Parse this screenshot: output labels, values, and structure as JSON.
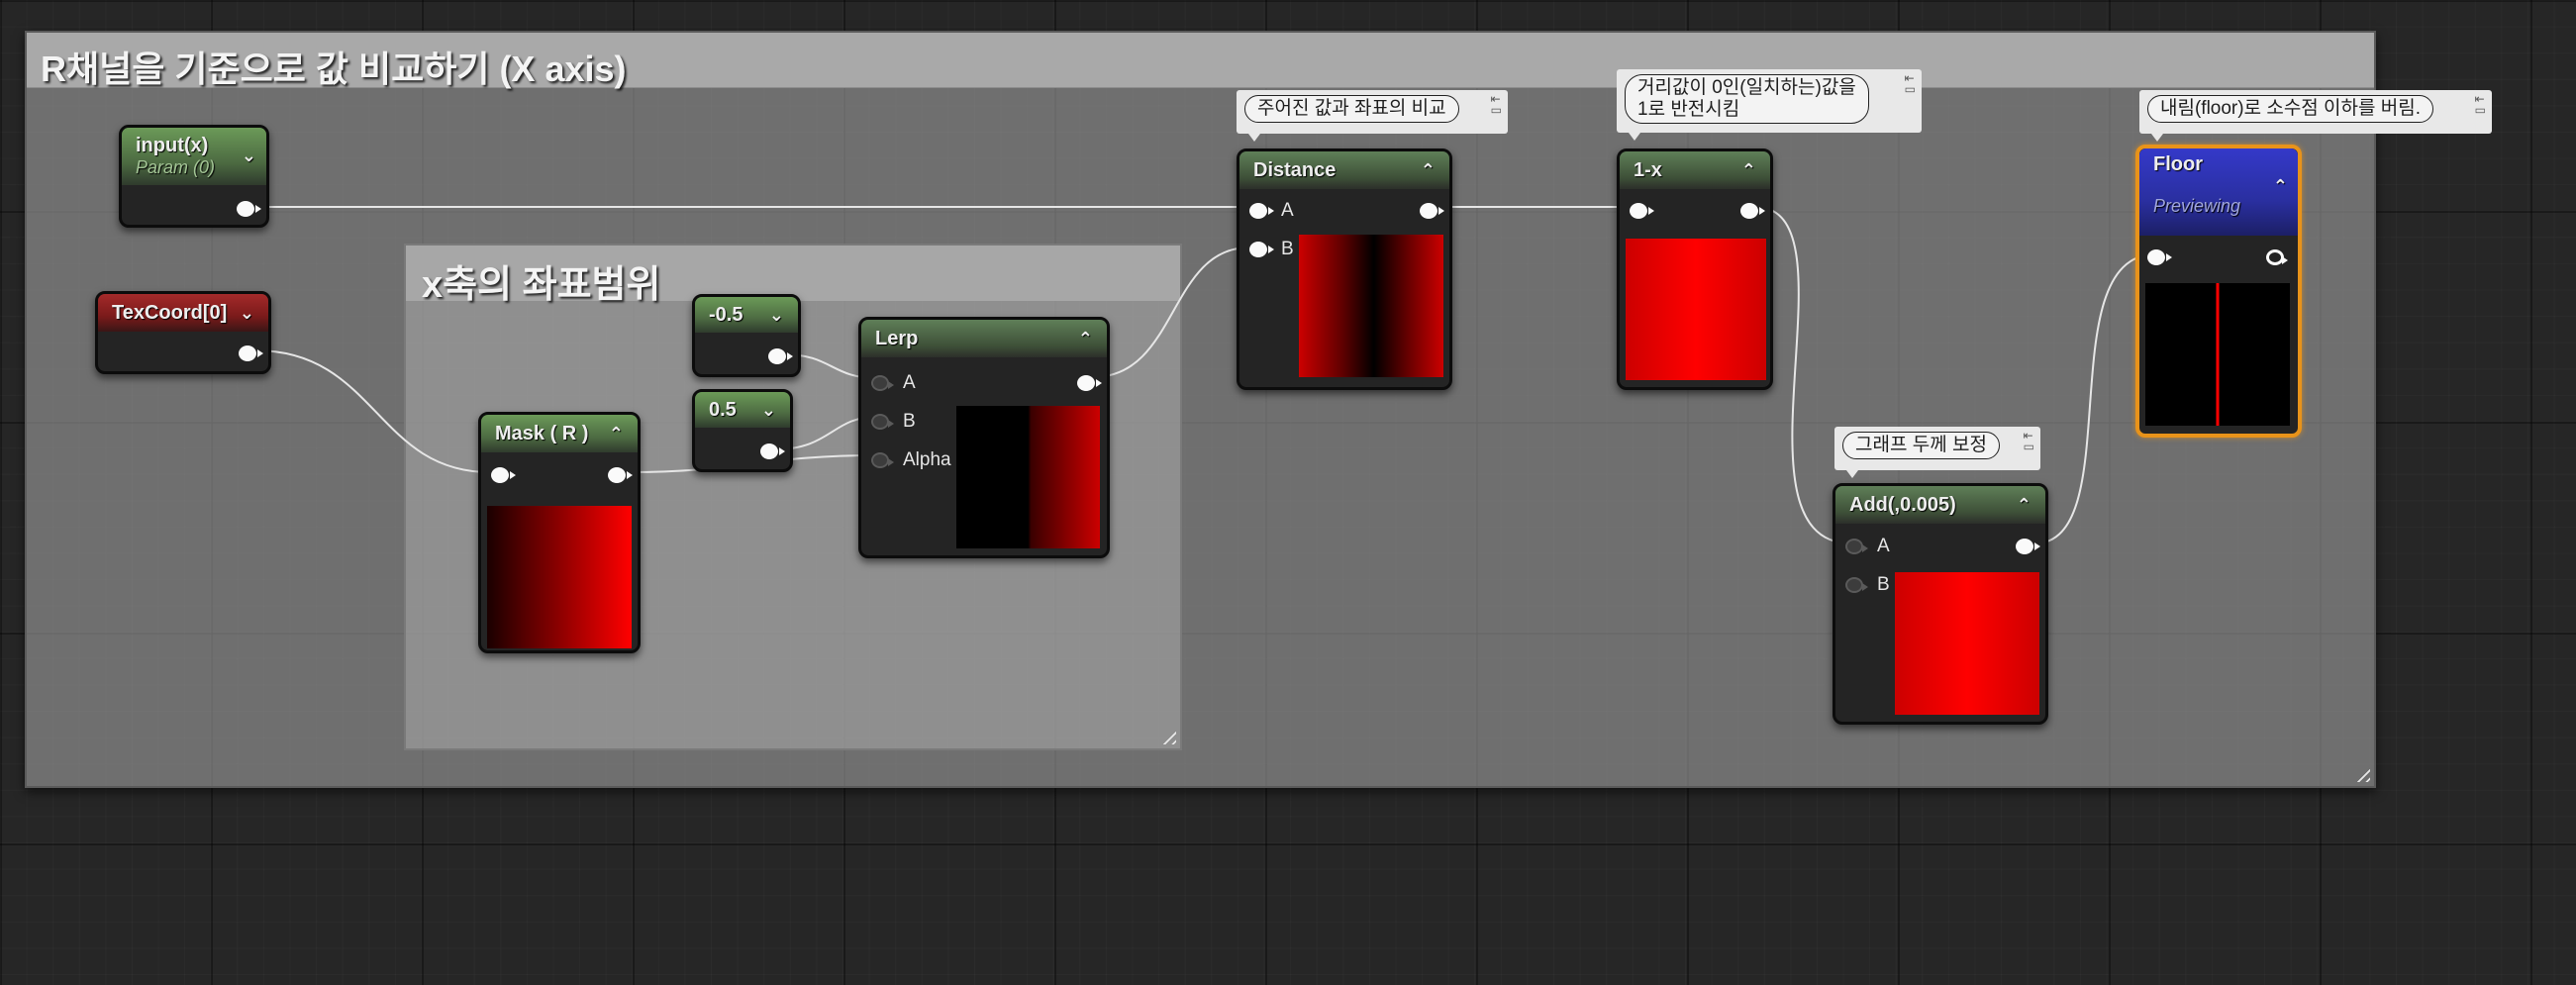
{
  "comments": {
    "main_title": "R채널을 기준으로 값 비교하기 (X axis)",
    "sub_title": "x축의 좌표범위"
  },
  "notes": {
    "distance_note": "주어진 값과 좌표의 비교",
    "one_minus_note_line1": "거리값이 0인(일치하는)값을",
    "one_minus_note_line2": "1로 반전시킴",
    "floor_note": "내림(floor)로 소수점 이하를 버림.",
    "add_note": "그래프 두께 보정"
  },
  "nodes": {
    "input": {
      "title": "input(x)",
      "subtitle": "Param (0)"
    },
    "texcoord": {
      "title": "TexCoord[0]"
    },
    "neg_half": {
      "title": "-0.5"
    },
    "half": {
      "title": "0.5"
    },
    "mask": {
      "title": "Mask ( R )"
    },
    "lerp": {
      "title": "Lerp",
      "pin_a": "A",
      "pin_b": "B",
      "pin_alpha": "Alpha"
    },
    "distance": {
      "title": "Distance",
      "pin_a": "A",
      "pin_b": "B"
    },
    "one_minus": {
      "title": "1-x"
    },
    "add": {
      "title": "Add(,0.005)",
      "pin_a": "A",
      "pin_b": "B"
    },
    "floor": {
      "title": "Floor",
      "subtitle": "Previewing"
    }
  },
  "colors": {
    "wire": "#e6e6e6",
    "preview_red": "#ff0000",
    "floor_border": "#e8931a"
  },
  "icons": {
    "collapse": "chevron-up-icon",
    "expand": "chevron-down-icon",
    "note_controls": "pin-icon"
  }
}
